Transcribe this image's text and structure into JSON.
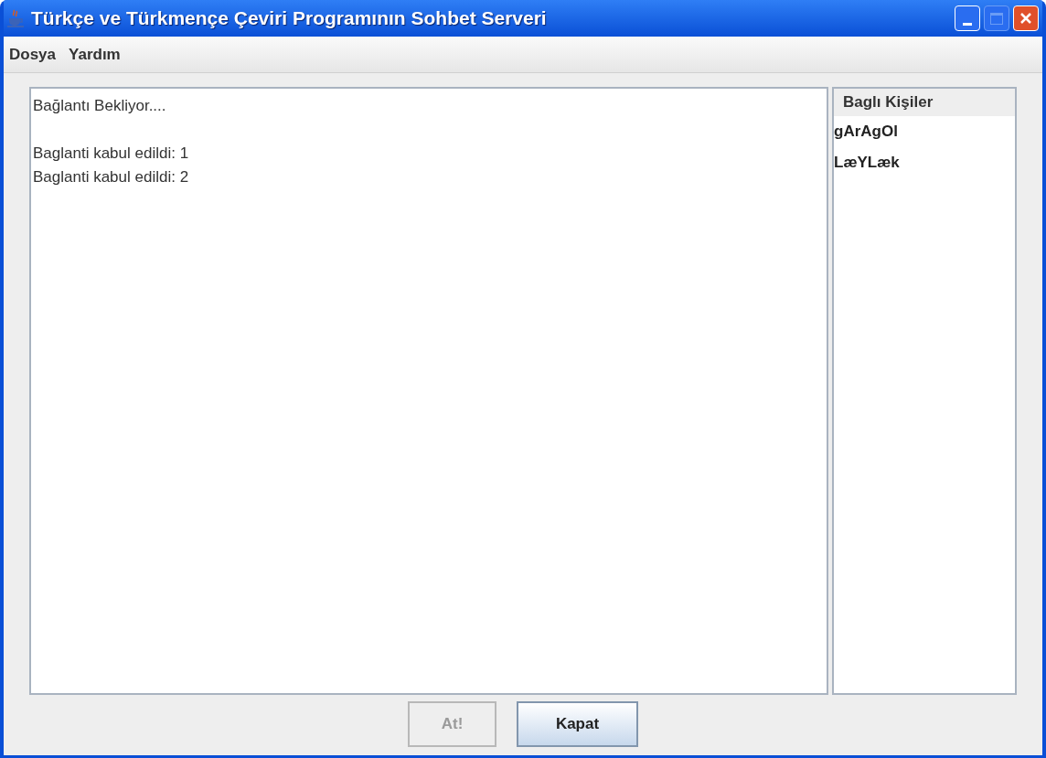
{
  "window": {
    "title": "Türkçe ve Türkmençe Çeviri Programının Sohbet Serveri"
  },
  "menu": [
    "Dosya",
    "Yardım"
  ],
  "log": [
    "Bağlantı Bekliyor....",
    "Baglanti kabul edildi: 1",
    "Baglanti kabul edildi: 2"
  ],
  "users": {
    "header": "Baglı Kişiler",
    "items": [
      "gArAgOl",
      "LæYLæk"
    ]
  },
  "buttons": [
    {
      "label": "At!",
      "disabled": true
    },
    {
      "label": "Kapat",
      "disabled": false
    }
  ]
}
